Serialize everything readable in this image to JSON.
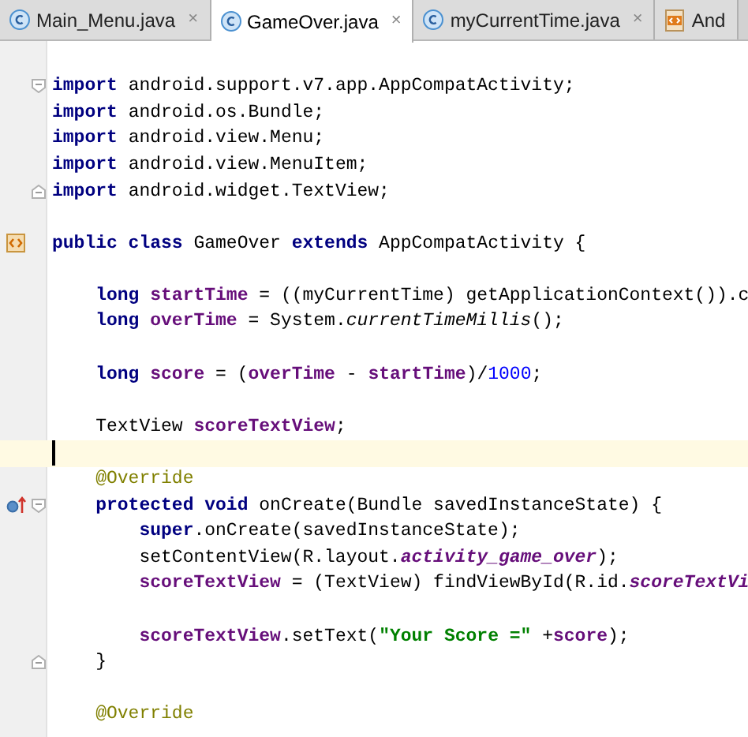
{
  "tabs": [
    {
      "label": "Main_Menu.java",
      "kind": "class",
      "close": "×",
      "selected": false
    },
    {
      "label": "GameOver.java",
      "kind": "class",
      "close": "×",
      "selected": true
    },
    {
      "label": "myCurrentTime.java",
      "kind": "class",
      "close": "×",
      "selected": false
    },
    {
      "label": "And",
      "kind": "layout",
      "selected": false
    }
  ],
  "lines": [
    {
      "current": false
    },
    {
      "current": false,
      "gutter": [
        {
          "kind": "fold-open"
        }
      ],
      "tokens": [
        {
          "kind": "keyword",
          "text": "import"
        },
        {
          "kind": "plain",
          "text": " android.support.v7.app.AppCompatActivity;"
        }
      ]
    },
    {
      "current": false,
      "tokens": [
        {
          "kind": "keyword",
          "text": "import"
        },
        {
          "kind": "plain",
          "text": " android.os.Bundle;"
        }
      ]
    },
    {
      "current": false,
      "tokens": [
        {
          "kind": "keyword",
          "text": "import"
        },
        {
          "kind": "plain",
          "text": " android.view.Menu;"
        }
      ]
    },
    {
      "current": false,
      "tokens": [
        {
          "kind": "keyword",
          "text": "import"
        },
        {
          "kind": "plain",
          "text": " android.view.MenuItem;"
        }
      ]
    },
    {
      "current": false,
      "gutter": [
        {
          "kind": "fold-close"
        }
      ],
      "tokens": [
        {
          "kind": "keyword",
          "text": "import"
        },
        {
          "kind": "plain",
          "text": " android.widget.TextView;"
        }
      ]
    },
    {
      "current": false
    },
    {
      "current": false,
      "gutter": [
        {
          "kind": "class-marker"
        }
      ],
      "tokens": [
        {
          "kind": "keyword",
          "text": "public class"
        },
        {
          "kind": "plain",
          "text": " GameOver "
        },
        {
          "kind": "keyword",
          "text": "extends"
        },
        {
          "kind": "plain",
          "text": " AppCompatActivity {"
        }
      ]
    },
    {
      "current": false
    },
    {
      "current": false,
      "tokens": [
        {
          "kind": "keyword",
          "text": "    long"
        },
        {
          "kind": "field",
          "text": " startTime"
        },
        {
          "kind": "plain",
          "text": " = ((myCurrentTime) getApplicationContext()).c"
        }
      ]
    },
    {
      "current": false,
      "tokens": [
        {
          "kind": "keyword",
          "text": "    long"
        },
        {
          "kind": "field",
          "text": " overTime"
        },
        {
          "kind": "plain",
          "text": " = System."
        },
        {
          "kind": "static",
          "text": "currentTimeMillis"
        },
        {
          "kind": "plain",
          "text": "();"
        }
      ]
    },
    {
      "current": false
    },
    {
      "current": false,
      "tokens": [
        {
          "kind": "keyword",
          "text": "    long"
        },
        {
          "kind": "field",
          "text": " score"
        },
        {
          "kind": "plain",
          "text": " = ("
        },
        {
          "kind": "field",
          "text": "overTime"
        },
        {
          "kind": "plain",
          "text": " - "
        },
        {
          "kind": "field",
          "text": "startTime"
        },
        {
          "kind": "plain",
          "text": ")/"
        },
        {
          "kind": "number",
          "text": "1000"
        },
        {
          "kind": "plain",
          "text": ";"
        }
      ]
    },
    {
      "current": false
    },
    {
      "current": false,
      "tokens": [
        {
          "kind": "plain",
          "text": "    TextView "
        },
        {
          "kind": "field",
          "text": "scoreTextView"
        },
        {
          "kind": "plain",
          "text": ";"
        }
      ]
    },
    {
      "current": true
    },
    {
      "current": false,
      "tokens": [
        {
          "kind": "annotation",
          "text": "    @Override"
        }
      ]
    },
    {
      "current": false,
      "gutter": [
        {
          "kind": "override-marker"
        },
        {
          "kind": "fold-open"
        }
      ],
      "tokens": [
        {
          "kind": "keyword",
          "text": "    protected void"
        },
        {
          "kind": "plain",
          "text": " onCreate(Bundle savedInstanceState) {"
        }
      ]
    },
    {
      "current": false,
      "tokens": [
        {
          "kind": "keyword",
          "text": "        super"
        },
        {
          "kind": "plain",
          "text": ".onCreate(savedInstanceState);"
        }
      ]
    },
    {
      "current": false,
      "tokens": [
        {
          "kind": "plain",
          "text": "        setContentView(R.layout."
        },
        {
          "kind": "static-field",
          "text": "activity_game_over"
        },
        {
          "kind": "plain",
          "text": ");"
        }
      ]
    },
    {
      "current": false,
      "tokens": [
        {
          "kind": "field",
          "text": "        scoreTextView"
        },
        {
          "kind": "plain",
          "text": " = (TextView) findViewById(R.id."
        },
        {
          "kind": "static-field",
          "text": "scoreTextVi"
        }
      ]
    },
    {
      "current": false
    },
    {
      "current": false,
      "tokens": [
        {
          "kind": "field",
          "text": "        scoreTextView"
        },
        {
          "kind": "plain",
          "text": ".setText("
        },
        {
          "kind": "string",
          "text": "\"Your Score =\""
        },
        {
          "kind": "plain",
          "text": " +"
        },
        {
          "kind": "field",
          "text": "score"
        },
        {
          "kind": "plain",
          "text": ");"
        }
      ]
    },
    {
      "current": false,
      "gutter": [
        {
          "kind": "fold-close"
        }
      ],
      "tokens": [
        {
          "kind": "plain",
          "text": "    }"
        }
      ]
    },
    {
      "current": false
    },
    {
      "current": false,
      "tokens": [
        {
          "kind": "annotation",
          "text": "    @Override"
        }
      ]
    }
  ]
}
